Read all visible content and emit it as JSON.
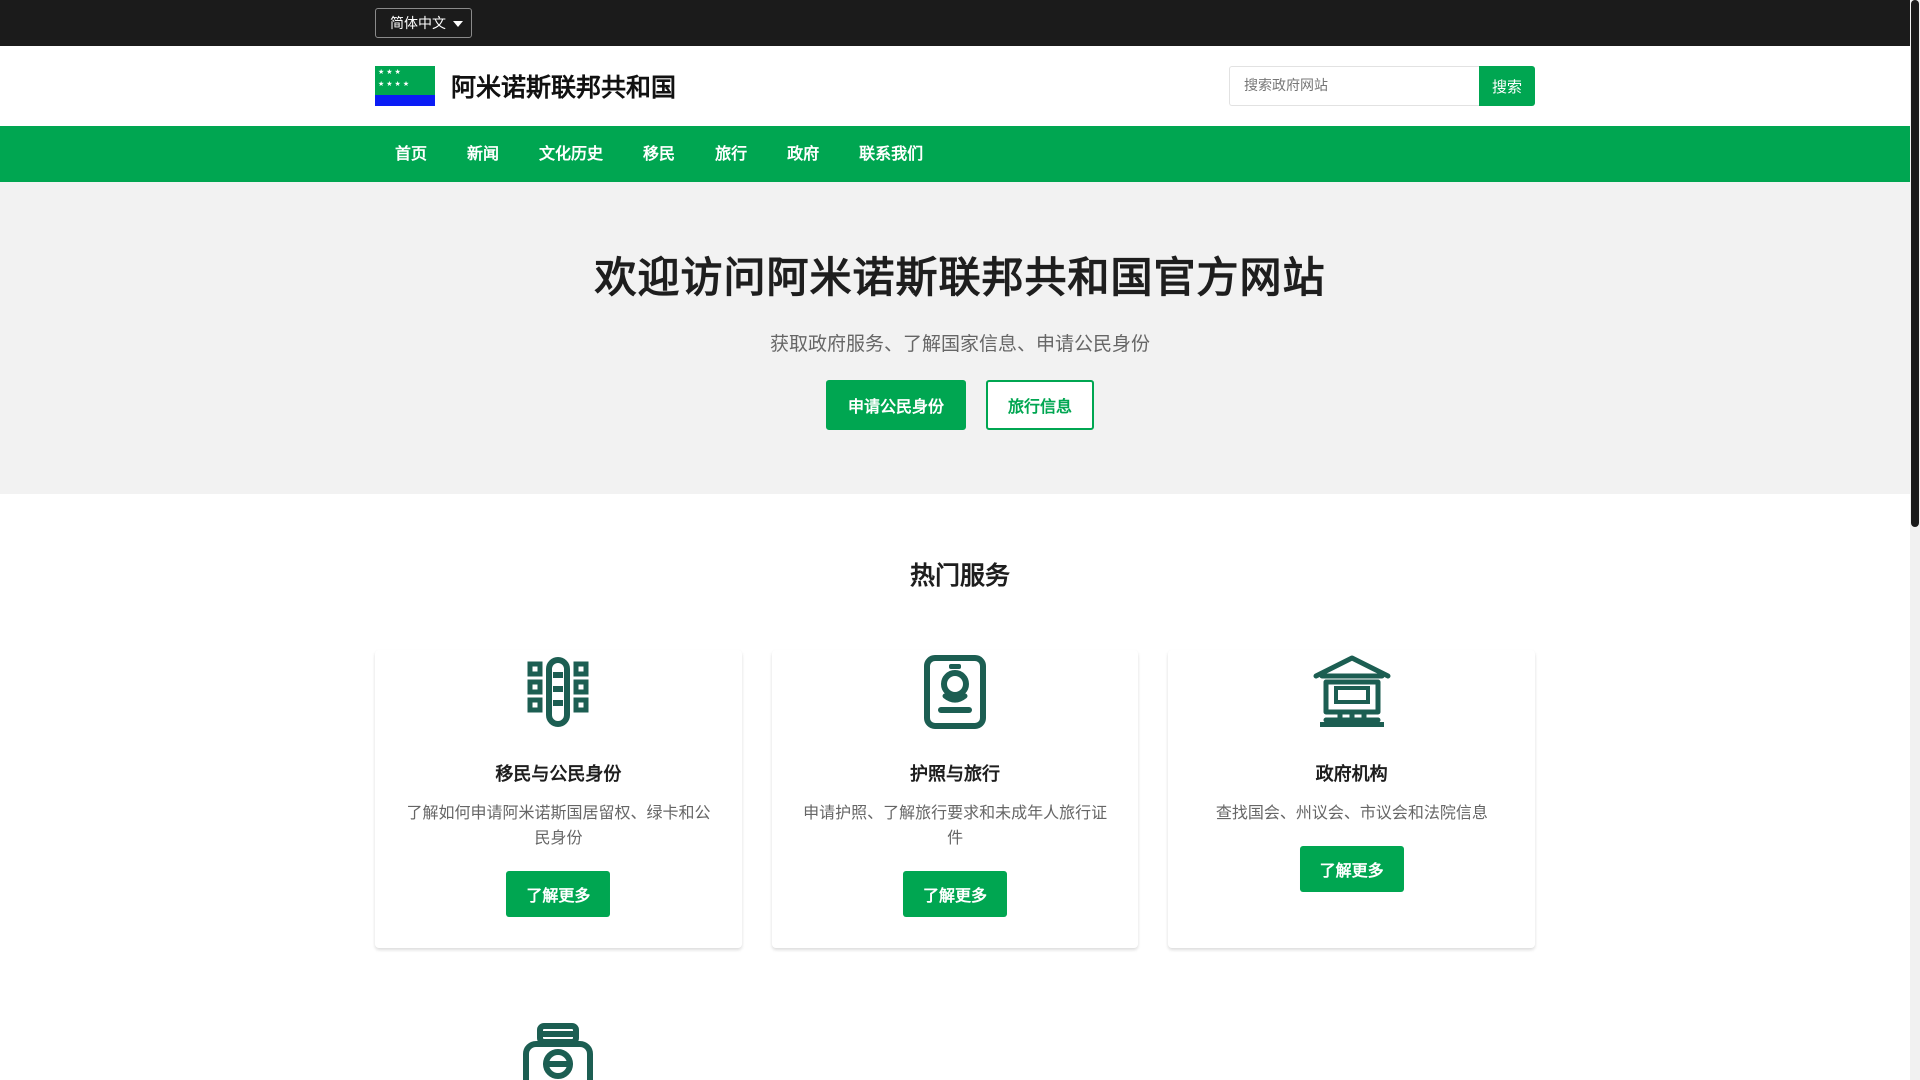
{
  "topbar": {
    "language": "简体中文"
  },
  "header": {
    "site_name": "阿米诺斯联邦共和国",
    "search_placeholder": "搜索政府网站",
    "search_button": "搜索",
    "flag_stars_row1": "★★★",
    "flag_stars_row2": "★★★★",
    "flag_colors": {
      "green": "#00a651",
      "blue": "#0a1cf5"
    }
  },
  "nav": {
    "items": [
      "首页",
      "新闻",
      "文化历史",
      "移民",
      "旅行",
      "政府",
      "联系我们"
    ]
  },
  "hero": {
    "title": "欢迎访问阿米诺斯联邦共和国官方网站",
    "subtitle": "获取政府服务、了解国家信息、申请公民身份",
    "primary_button": "申请公民身份",
    "secondary_button": "旅行信息"
  },
  "services": {
    "title": "热门服务",
    "cards": [
      {
        "icon": "building-grid-icon",
        "title": "移民与公民身份",
        "description": "了解如何申请阿米诺斯国居留权、绿卡和公民身份",
        "button": "了解更多"
      },
      {
        "icon": "passport-icon",
        "title": "护照与旅行",
        "description": "申请护照、了解旅行要求和未成年人旅行证件",
        "button": "了解更多"
      },
      {
        "icon": "government-building-icon",
        "title": "政府机构",
        "description": "查找国会、州议会、市议会和法院信息",
        "button": "了解更多"
      }
    ],
    "partial_card_icon": "robot-helper-icon"
  },
  "colors": {
    "accent": "#00a651",
    "icon": "#1c5e52",
    "topbar": "#1b1b1b",
    "hero_bg": "#f2f2f2"
  }
}
